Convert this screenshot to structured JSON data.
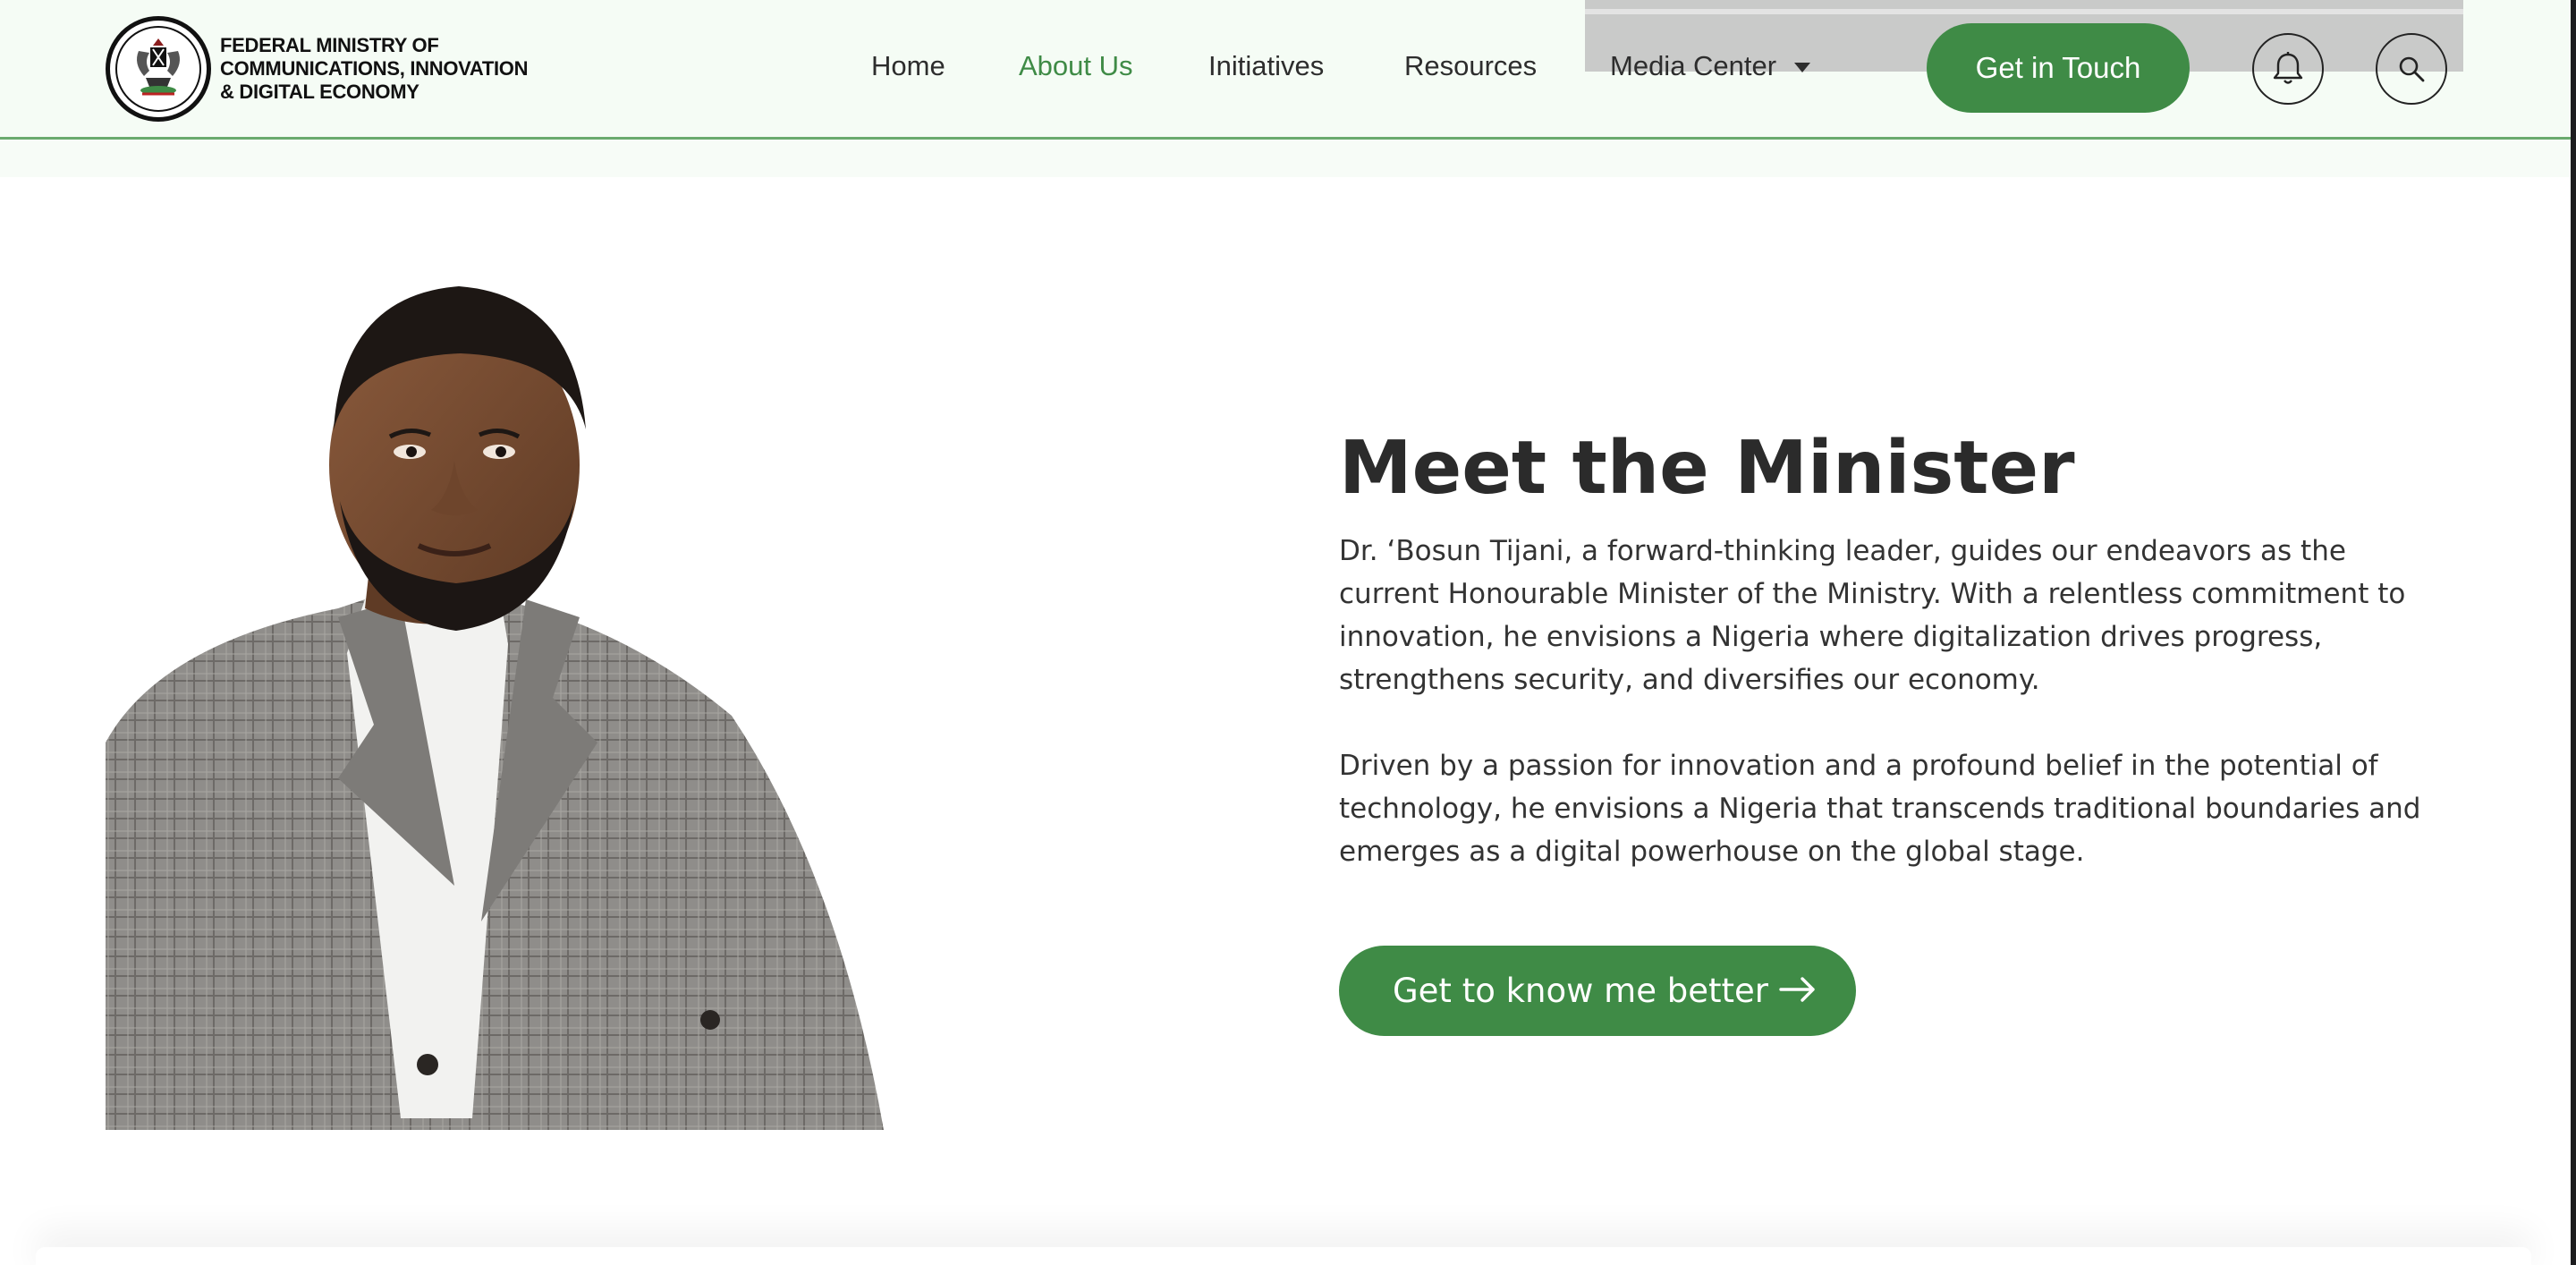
{
  "header": {
    "logo_lines": [
      "FEDERAL MINISTRY OF",
      "COMMUNICATIONS, INNOVATION",
      "& DIGITAL ECONOMY"
    ],
    "nav": [
      {
        "label": "Home",
        "active": false
      },
      {
        "label": "About Us",
        "active": true
      },
      {
        "label": "Initiatives",
        "active": false
      },
      {
        "label": "Resources",
        "active": false
      },
      {
        "label": "Media Center",
        "active": false,
        "has_dropdown": true
      }
    ],
    "cta_label": "Get in Touch",
    "icons": [
      "bell-icon",
      "search-icon"
    ]
  },
  "main": {
    "title": "Meet the Minister",
    "paragraphs": [
      "Dr. ‘Bosun Tijani, a forward-thinking leader, guides our endeavors as the current Honourable Minister of the Ministry. With a relentless commitment to innovation, he envisions a Nigeria where digitalization drives progress, strengthens security, and diversifies our economy.",
      "Driven by a passion for innovation and a profound belief in the potential of technology, he envisions a Nigeria that transcends traditional boundaries and emerges as a digital powerhouse on the global stage."
    ],
    "button_label": "Get to know me better",
    "button_icon": "arrow-right-icon"
  },
  "colors": {
    "brand_green": "#3f8b46",
    "header_bg": "#f5fcf5",
    "text": "#2b2b2b"
  }
}
